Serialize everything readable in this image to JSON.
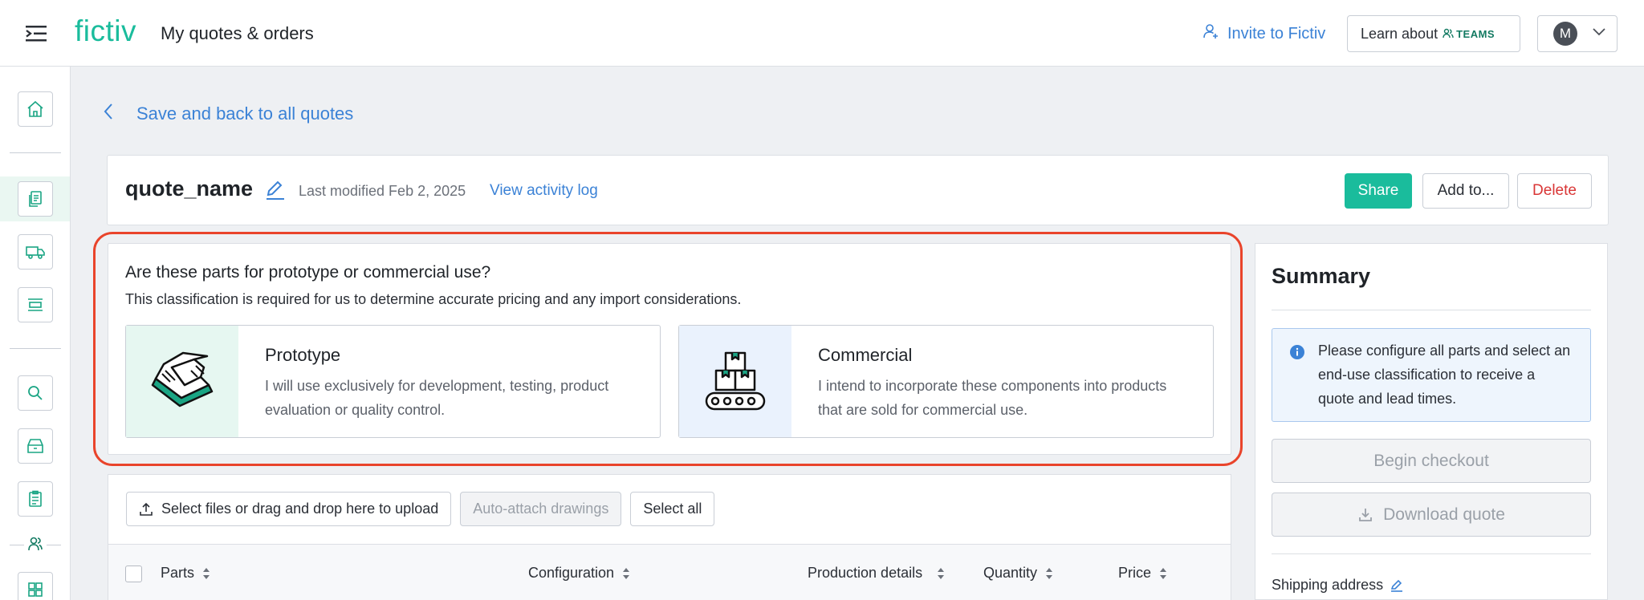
{
  "header": {
    "logo": "fictiv",
    "title": "My quotes & orders",
    "invite_label": "Invite to Fictiv",
    "learn_label": "Learn about",
    "teams_label": "TEAMS",
    "avatar_initial": "M"
  },
  "nav": {
    "back_label": "Save and back to all quotes"
  },
  "quote": {
    "name": "quote_name",
    "last_modified": "Last modified Feb 2, 2025",
    "activity_link": "View activity log",
    "share_label": "Share",
    "add_label": "Add to...",
    "delete_label": "Delete"
  },
  "classification": {
    "question": "Are these parts for prototype or commercial use?",
    "subtitle": "This classification is required for us to determine accurate pricing and any import considerations.",
    "options": [
      {
        "title": "Prototype",
        "description": "I will use exclusively for development, testing, product evaluation or quality control.",
        "icon": "prototype-part-icon"
      },
      {
        "title": "Commercial",
        "description": "I intend to incorporate these components into products that are sold for commercial use.",
        "icon": "conveyor-boxes-icon"
      }
    ]
  },
  "parts": {
    "upload_label": "Select files or drag and drop here to upload",
    "auto_attach_label": "Auto-attach drawings",
    "select_all_label": "Select all",
    "columns": [
      "Parts",
      "Configuration",
      "Production details",
      "Quantity",
      "Price"
    ]
  },
  "summary": {
    "title": "Summary",
    "info": "Please configure all parts and select an end-use classification to receive a quote and lead times.",
    "checkout_label": "Begin checkout",
    "download_label": "Download quote",
    "shipping_label": "Shipping address"
  },
  "colors": {
    "brand": "#1abc9c",
    "link": "#3b82d6",
    "danger": "#d93636",
    "highlight": "#e9442b"
  }
}
